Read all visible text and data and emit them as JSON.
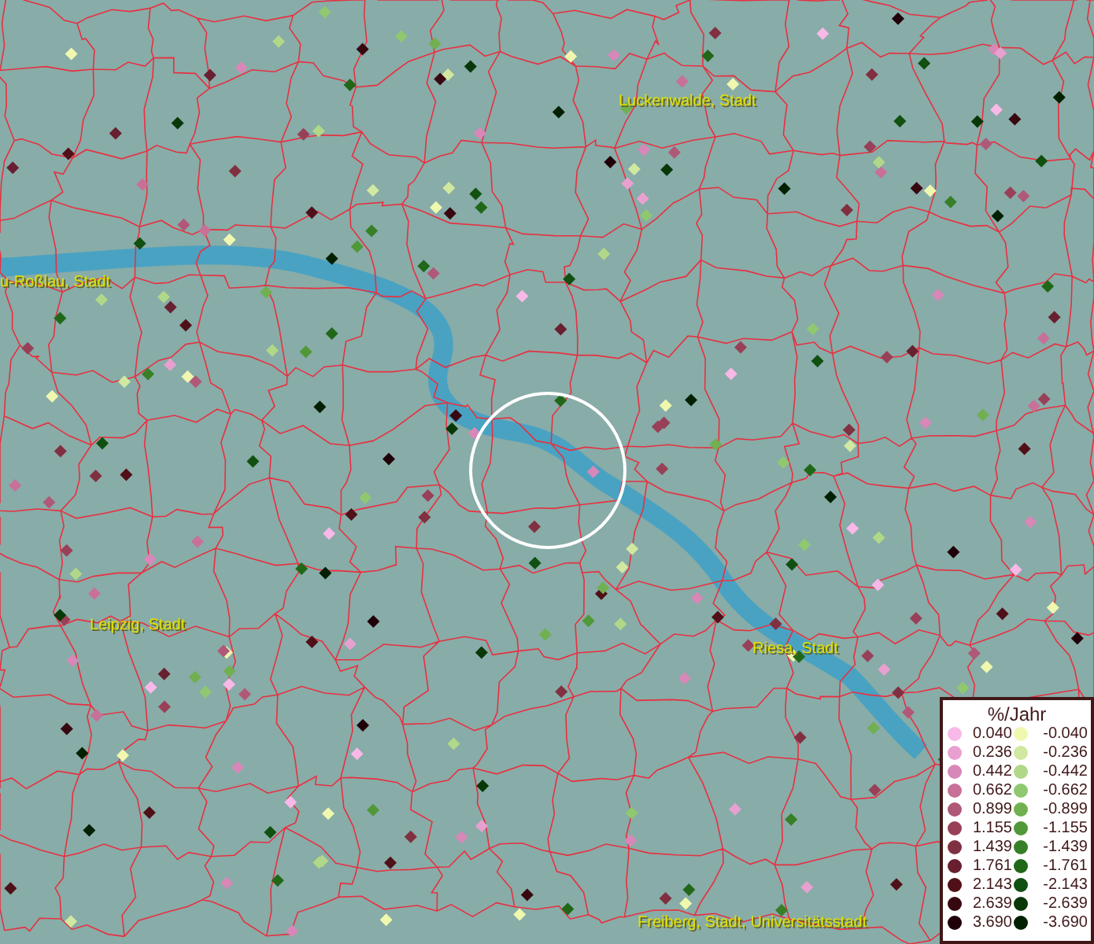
{
  "map": {
    "place_labels": [
      {
        "text": "u-Roßlau, Stadt"
      },
      {
        "text": "Luckenwalde, Stadt"
      },
      {
        "text": "Leipzig, Stadt"
      },
      {
        "text": "Riesa, Stadt"
      },
      {
        "text": "Freiberg, Stadt, Universitätsstadt"
      }
    ]
  },
  "legend": {
    "title": "%/Jahr",
    "positive": [
      {
        "label": "0.040",
        "color": "#f8b8e8"
      },
      {
        "label": "0.236",
        "color": "#e8a0d0"
      },
      {
        "label": "0.442",
        "color": "#d888b8"
      },
      {
        "label": "0.662",
        "color": "#c87098"
      },
      {
        "label": "0.899",
        "color": "#b05878"
      },
      {
        "label": "1.155",
        "color": "#984058"
      },
      {
        "label": "1.439",
        "color": "#803040"
      },
      {
        "label": "1.761",
        "color": "#682030"
      },
      {
        "label": "2.143",
        "color": "#501018"
      },
      {
        "label": "2.639",
        "color": "#380810"
      },
      {
        "label": "3.690",
        "color": "#200008"
      }
    ],
    "negative": [
      {
        "label": "-0.040",
        "color": "#f0f8b0"
      },
      {
        "label": "-0.236",
        "color": "#d0e8a0"
      },
      {
        "label": "-0.442",
        "color": "#b0d888"
      },
      {
        "label": "-0.662",
        "color": "#90c870"
      },
      {
        "label": "-0.899",
        "color": "#70b050"
      },
      {
        "label": "-1.155",
        "color": "#509838"
      },
      {
        "label": "-1.439",
        "color": "#388028"
      },
      {
        "label": "-1.761",
        "color": "#206818"
      },
      {
        "label": "-2.143",
        "color": "#105010"
      },
      {
        "label": "-2.639",
        "color": "#083808"
      },
      {
        "label": "-3.690",
        "color": "#002000"
      }
    ]
  }
}
